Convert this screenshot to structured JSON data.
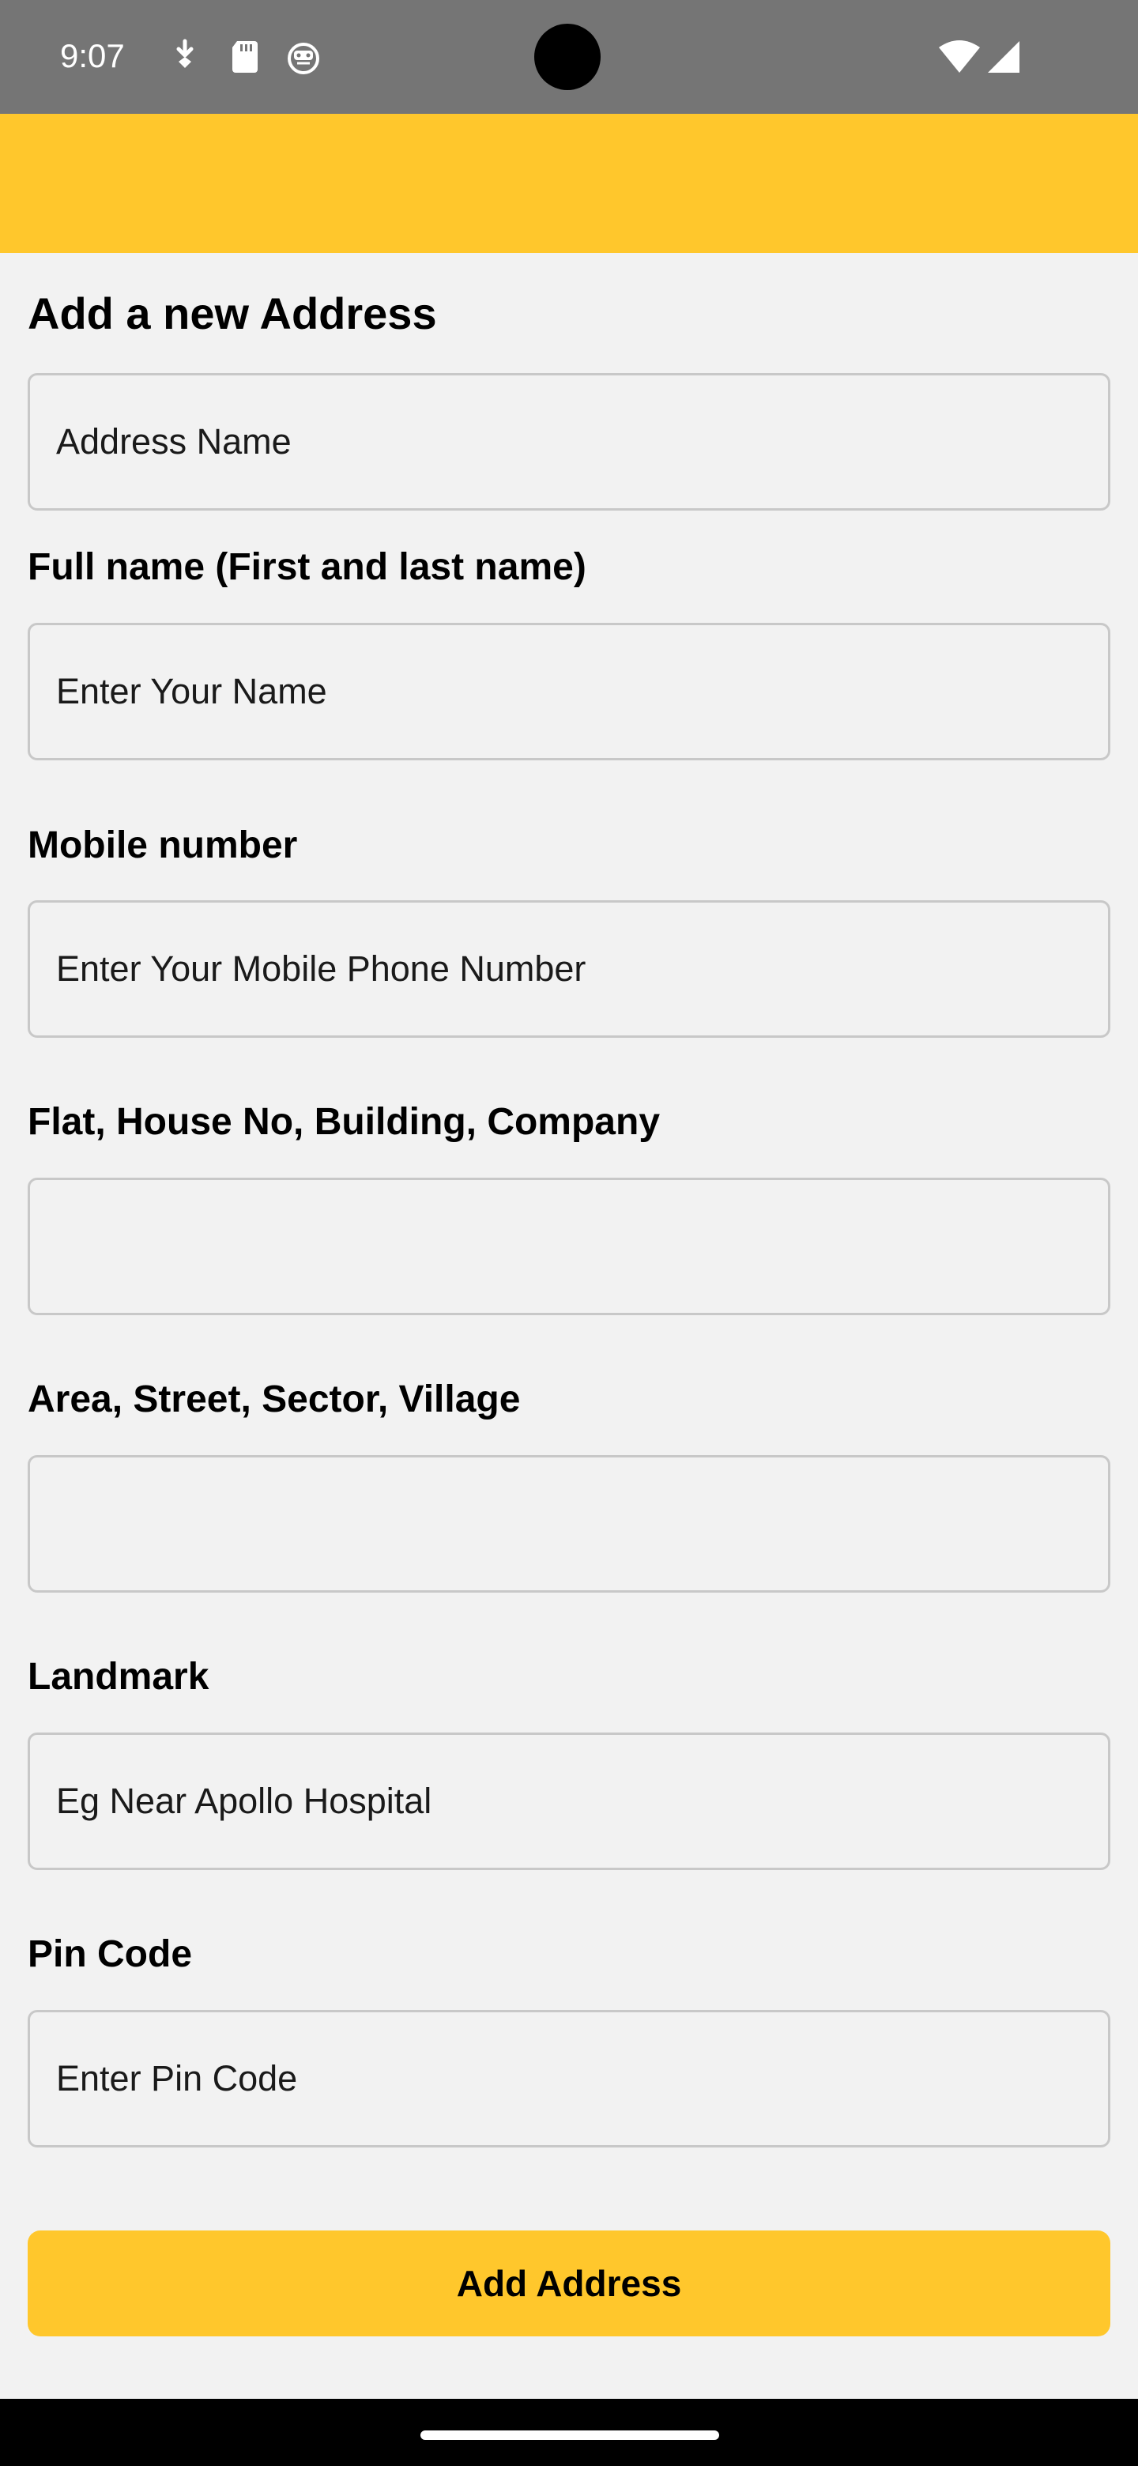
{
  "status_bar": {
    "time": "9:07",
    "icons": [
      "download-icon",
      "sd-card-icon",
      "robot-face-icon",
      "wifi-icon",
      "cellular-signal-icon"
    ],
    "background": "#757575"
  },
  "header": {
    "background": "#ffc72c"
  },
  "form": {
    "title": "Add a new Address",
    "address_name": {
      "label": "",
      "placeholder": "Address Name",
      "value": ""
    },
    "full_name": {
      "label": "Full name (First and last name)",
      "placeholder": "Enter Your Name",
      "value": ""
    },
    "mobile": {
      "label": "Mobile number",
      "placeholder": "Enter Your Mobile Phone Number",
      "value": ""
    },
    "flat": {
      "label": "Flat, House No, Building, Company",
      "placeholder": "",
      "value": ""
    },
    "area": {
      "label": "Area, Street, Sector, Village",
      "placeholder": "",
      "value": ""
    },
    "landmark": {
      "label": "Landmark",
      "placeholder": "Eg Near Apollo Hospital",
      "value": ""
    },
    "pin": {
      "label": "Pin Code",
      "placeholder": "Enter Pin Code",
      "value": ""
    },
    "submit_label": "Add Address"
  },
  "colors": {
    "accent": "#ffc72c",
    "page_background": "#f2f2f2",
    "input_border": "#c8c8c8"
  }
}
